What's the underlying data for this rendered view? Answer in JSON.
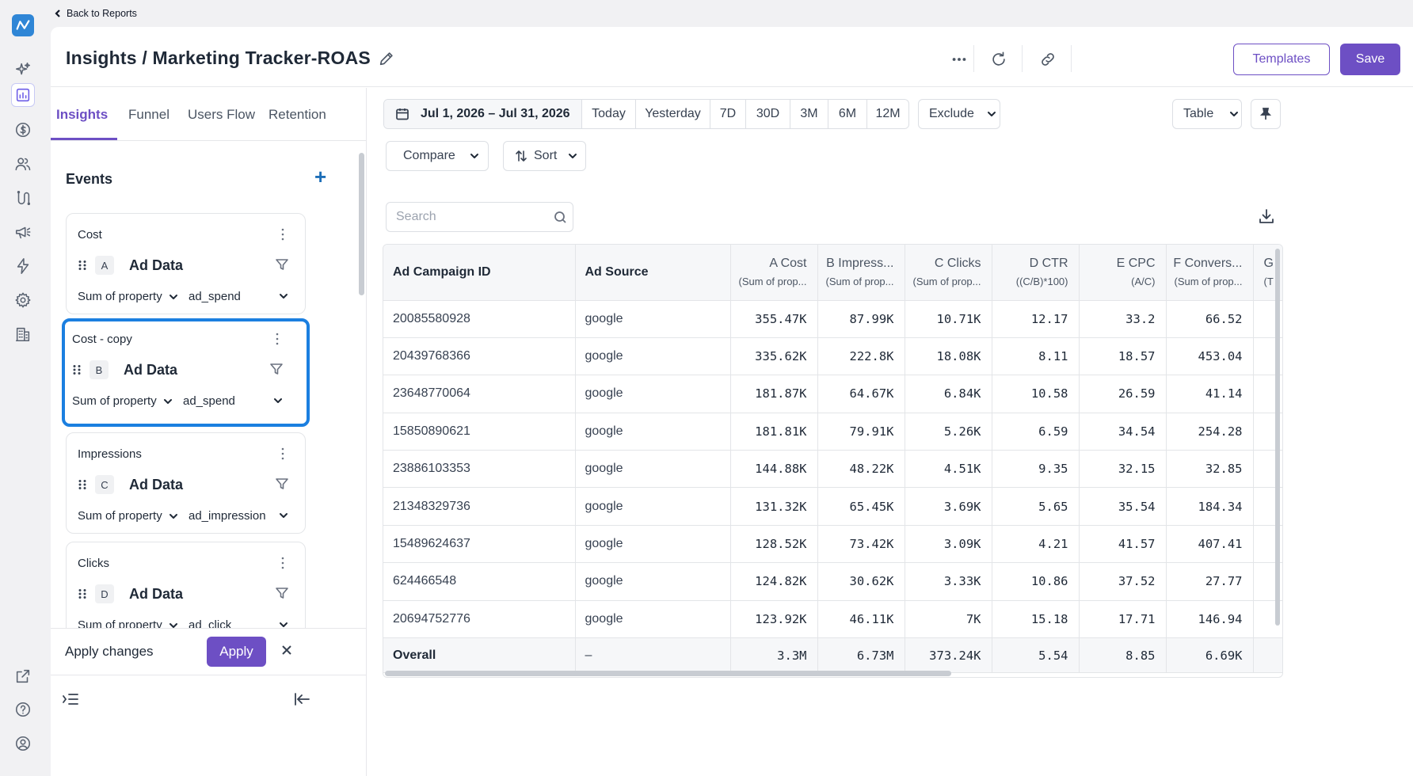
{
  "nav": {
    "back_label": "Back to Reports",
    "rail_icons": [
      "sparkle-icon",
      "report-icon",
      "dollar-icon",
      "users-icon",
      "journey-icon",
      "megaphone-icon",
      "bolt-icon",
      "gear-icon",
      "building-icon",
      "external-link-icon",
      "help-icon",
      "profile-icon"
    ]
  },
  "header": {
    "title": "Insights / Marketing Tracker-ROAS",
    "templates_label": "Templates",
    "save_label": "Save"
  },
  "tabs": [
    {
      "label": "Insights",
      "active": true
    },
    {
      "label": "Funnel",
      "active": false
    },
    {
      "label": "Users Flow",
      "active": false
    },
    {
      "label": "Retention",
      "active": false
    }
  ],
  "events": {
    "heading": "Events",
    "add_label": "+",
    "items": [
      {
        "name": "Cost",
        "letter": "A",
        "source": "Ad Data",
        "aggregation": "Sum of property",
        "property": "ad_spend",
        "selected": false
      },
      {
        "name": "Cost - copy",
        "letter": "B",
        "source": "Ad Data",
        "aggregation": "Sum of property",
        "property": "ad_spend",
        "selected": true
      },
      {
        "name": "Impressions",
        "letter": "C",
        "source": "Ad Data",
        "aggregation": "Sum of property",
        "property": "ad_impression",
        "selected": false
      },
      {
        "name": "Clicks",
        "letter": "D",
        "source": "Ad Data",
        "aggregation": "Sum of property",
        "property": "ad_click",
        "selected": false
      }
    ]
  },
  "applybar": {
    "text": "Apply changes",
    "apply_label": "Apply"
  },
  "toolbar": {
    "date_range": "Jul 1, 2026 – Jul 31, 2026",
    "quick_ranges": [
      "Today",
      "Yesterday",
      "7D",
      "30D",
      "3M",
      "6M",
      "12M"
    ],
    "exclude_label": "Exclude",
    "view_label": "Table",
    "compare_label": "Compare",
    "sort_label": "Sort",
    "search_placeholder": "Search"
  },
  "table": {
    "columns": [
      {
        "label": "Ad Campaign ID",
        "sub": ""
      },
      {
        "label": "Ad Source",
        "sub": ""
      },
      {
        "label": "A Cost",
        "sub": "(Sum of prop..."
      },
      {
        "label": "B Impress...",
        "sub": "(Sum of prop..."
      },
      {
        "label": "C Clicks",
        "sub": "(Sum of prop..."
      },
      {
        "label": "D CTR",
        "sub": "((C/B)*100)"
      },
      {
        "label": "E CPC",
        "sub": "(A/C)"
      },
      {
        "label": "F Convers...",
        "sub": "(Sum of prop..."
      },
      {
        "label": "G",
        "sub": "(T"
      }
    ],
    "rows": [
      [
        "20085580928",
        "google",
        "355.47K",
        "87.99K",
        "10.71K",
        "12.17",
        "33.2",
        "66.52",
        ""
      ],
      [
        "20439768366",
        "google",
        "335.62K",
        "222.8K",
        "18.08K",
        "8.11",
        "18.57",
        "453.04",
        ""
      ],
      [
        "23648770064",
        "google",
        "181.87K",
        "64.67K",
        "6.84K",
        "10.58",
        "26.59",
        "41.14",
        ""
      ],
      [
        "15850890621",
        "google",
        "181.81K",
        "79.91K",
        "5.26K",
        "6.59",
        "34.54",
        "254.28",
        ""
      ],
      [
        "23886103353",
        "google",
        "144.88K",
        "48.22K",
        "4.51K",
        "9.35",
        "32.15",
        "32.85",
        ""
      ],
      [
        "21348329736",
        "google",
        "131.32K",
        "65.45K",
        "3.69K",
        "5.65",
        "35.54",
        "184.34",
        ""
      ],
      [
        "15489624637",
        "google",
        "128.52K",
        "73.42K",
        "3.09K",
        "4.21",
        "41.57",
        "407.41",
        ""
      ],
      [
        "624466548",
        "google",
        "124.82K",
        "30.62K",
        "3.33K",
        "10.86",
        "37.52",
        "27.77",
        ""
      ],
      [
        "20694752776",
        "google",
        "123.92K",
        "46.11K",
        "7K",
        "15.18",
        "17.71",
        "146.94",
        ""
      ]
    ],
    "overall": [
      "Overall",
      "–",
      "3.3M",
      "6.73M",
      "373.24K",
      "5.54",
      "8.85",
      "6.69K",
      ""
    ]
  }
}
